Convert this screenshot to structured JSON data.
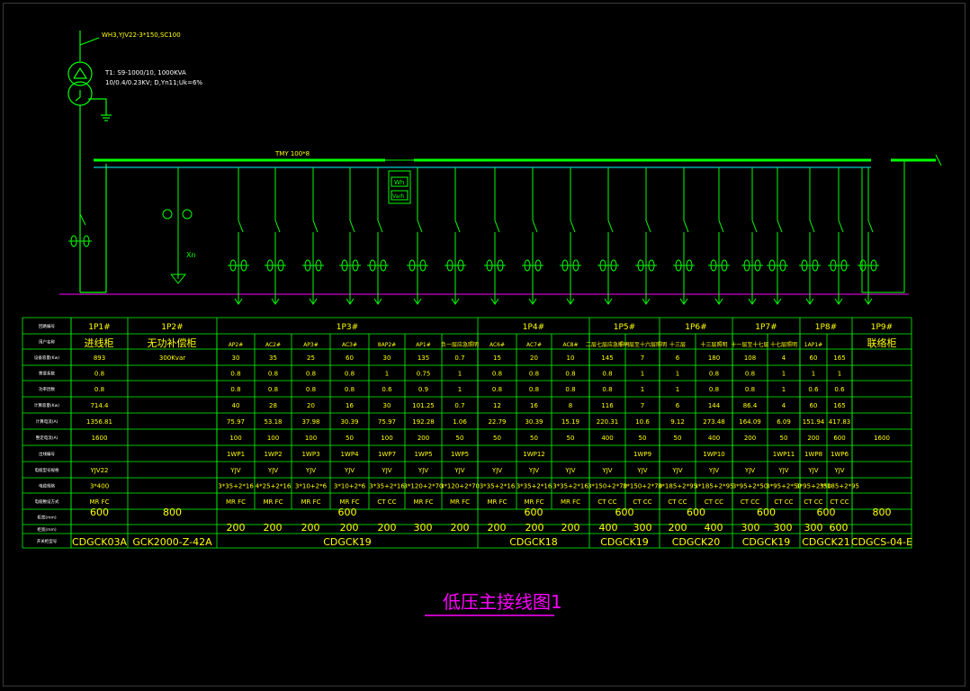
{
  "colors": {
    "background": "#000000",
    "line": "#00ff00",
    "table_text": "#ffff00",
    "busbar_cyan": "#00ffff",
    "ground_magenta": "#ff00ff",
    "title": "#ff00ff"
  },
  "top": {
    "incoming_cable": "WH3,YJV22-3*150,SC100",
    "transformer_line1": "T1:  S9-1000/10,  1000KVA",
    "transformer_line2": "10/0.4/0.23KV; D,Yn11;Uk=6%",
    "busbar_label": "TMY  100*8",
    "meter_wh": "Wh",
    "meter_varh": "Varh",
    "capacitor_label": "Xn"
  },
  "title": "低压主接线图1",
  "table": {
    "row_labels": [
      "回路编号",
      "用户名称",
      "设备容量(Kw)",
      "需要系数",
      "功率因数",
      "计算容量(Kw)",
      "计算电流(A)",
      "整定电流(A)",
      "出线编号",
      "电缆型号规格",
      "电缆规格",
      "电缆敷设方式",
      "柜宽(mm)",
      "柜宽(mm)",
      "开关柜型号"
    ],
    "panels": [
      "1P1#",
      "1P2#",
      "1P3#",
      "1P4#",
      "1P5#",
      "1P6#",
      "1P7#",
      "1P8#",
      "1P9#"
    ],
    "row2_fixed": {
      "c0": "进线柜",
      "c1": "无功补偿柜",
      "c21": "联络柜"
    },
    "circuits": [
      "AP2#",
      "AC2#",
      "AP3#",
      "AC3#",
      "8AP2#",
      "AP1#",
      "负一层应急照明",
      "AC6#",
      "AC7#",
      "AC8#",
      "二层七层应急照明",
      "十一层至十六层照明",
      "十三层",
      "十三层照明",
      "十一层至十七层",
      "十七层照明",
      "1AP1#"
    ],
    "rows": {
      "capacity": [
        "893",
        "300Kvar",
        "30",
        "35",
        "25",
        "60",
        "30",
        "135",
        "0.7",
        "15",
        "20",
        "10",
        "145",
        "7",
        "6",
        "180",
        "108",
        "4",
        "60",
        "165",
        ""
      ],
      "demand": [
        "0.8",
        "",
        "0.8",
        "0.8",
        "0.8",
        "0.8",
        "1",
        "0.75",
        "1",
        "0.8",
        "0.8",
        "0.8",
        "0.8",
        "1",
        "1",
        "0.8",
        "0.8",
        "1",
        "1",
        "1",
        ""
      ],
      "pf": [
        "0.8",
        "",
        "0.8",
        "0.8",
        "0.8",
        "0.8",
        "0.6",
        "0.9",
        "1",
        "0.8",
        "0.8",
        "0.8",
        "0.8",
        "1",
        "1",
        "0.8",
        "0.8",
        "1",
        "0.6",
        "0.6",
        ""
      ],
      "calc_kw": [
        "714.4",
        "",
        "40",
        "28",
        "20",
        "16",
        "30",
        "101.25",
        "0.7",
        "12",
        "16",
        "8",
        "116",
        "7",
        "6",
        "144",
        "86.4",
        "4",
        "60",
        "165",
        ""
      ],
      "calc_a": [
        "1356.81",
        "",
        "75.97",
        "53.18",
        "37.98",
        "30.39",
        "75.97",
        "192.28",
        "1.06",
        "22.79",
        "30.39",
        "15.19",
        "220.31",
        "10.6",
        "9.12",
        "273.48",
        "164.09",
        "6.09",
        "151.94",
        "417.83",
        ""
      ],
      "set_a": [
        "1600",
        "",
        "100",
        "100",
        "100",
        "50",
        "100",
        "200",
        "50",
        "50",
        "50",
        "50",
        "400",
        "50",
        "50",
        "400",
        "200",
        "50",
        "200",
        "600",
        "1600"
      ],
      "outlet": [
        "",
        "",
        "1WP1",
        "1WP2",
        "1WP3",
        "1WP4",
        "1WP7",
        "1WP5",
        "1WP5",
        "",
        "1WP12",
        "",
        "",
        "1WP9",
        "",
        "1WP10",
        "",
        "1WP11",
        "1WP8",
        "1WP6",
        ""
      ],
      "cable": [
        "YJV22",
        "",
        "YJV",
        "YJV",
        "YJV",
        "YJV",
        "YJV",
        "YJV",
        "YJV",
        "YJV",
        "YJV",
        "YJV",
        "YJV",
        "YJV",
        "YJV",
        "YJV",
        "YJV",
        "YJV",
        "YJV",
        "YJV",
        ""
      ],
      "spec": [
        "3*400",
        "",
        "3*35+2*16",
        "4*25+2*16",
        "3*10+2*6",
        "3*10+2*6",
        "3*35+2*16",
        "3*120+2*70",
        "3*120+2*70",
        "3*35+2*16",
        "3*35+2*16",
        "3*35+2*16",
        "3*150+2*70",
        "3*150+2*70",
        "3*185+2*95",
        "3*185+2*95",
        "3*95+2*50",
        "3*95+2*50",
        "3*95+2*50",
        "3*185+2*95",
        ""
      ],
      "lay": [
        "MR FC",
        "",
        "MR FC",
        "MR FC",
        "MR FC",
        "MR FC",
        "CT CC",
        "MR FC",
        "MR FC",
        "MR FC",
        "MR FC",
        "MR FC",
        "CT CC",
        "CT CC",
        "CT CC",
        "CT CC",
        "CT CC",
        "CT CC",
        "CT CC",
        "CT CC",
        ""
      ]
    },
    "width1": [
      "600",
      "800",
      "600",
      "600",
      "600",
      "600",
      "600",
      "600",
      "800"
    ],
    "width2": [
      "200",
      "200",
      "200",
      "200",
      "200",
      "300",
      "200",
      "200",
      "200",
      "200",
      "400",
      "300",
      "200",
      "400",
      "300",
      "300",
      "300",
      "600"
    ],
    "models": [
      "CDGCK03A",
      "GCK2000-Z-42A",
      "CDGCK19",
      "CDGCK18",
      "CDGCK19",
      "CDGCK20",
      "CDGCK19",
      "CDGCK21",
      "CDGCS-04-E"
    ]
  }
}
